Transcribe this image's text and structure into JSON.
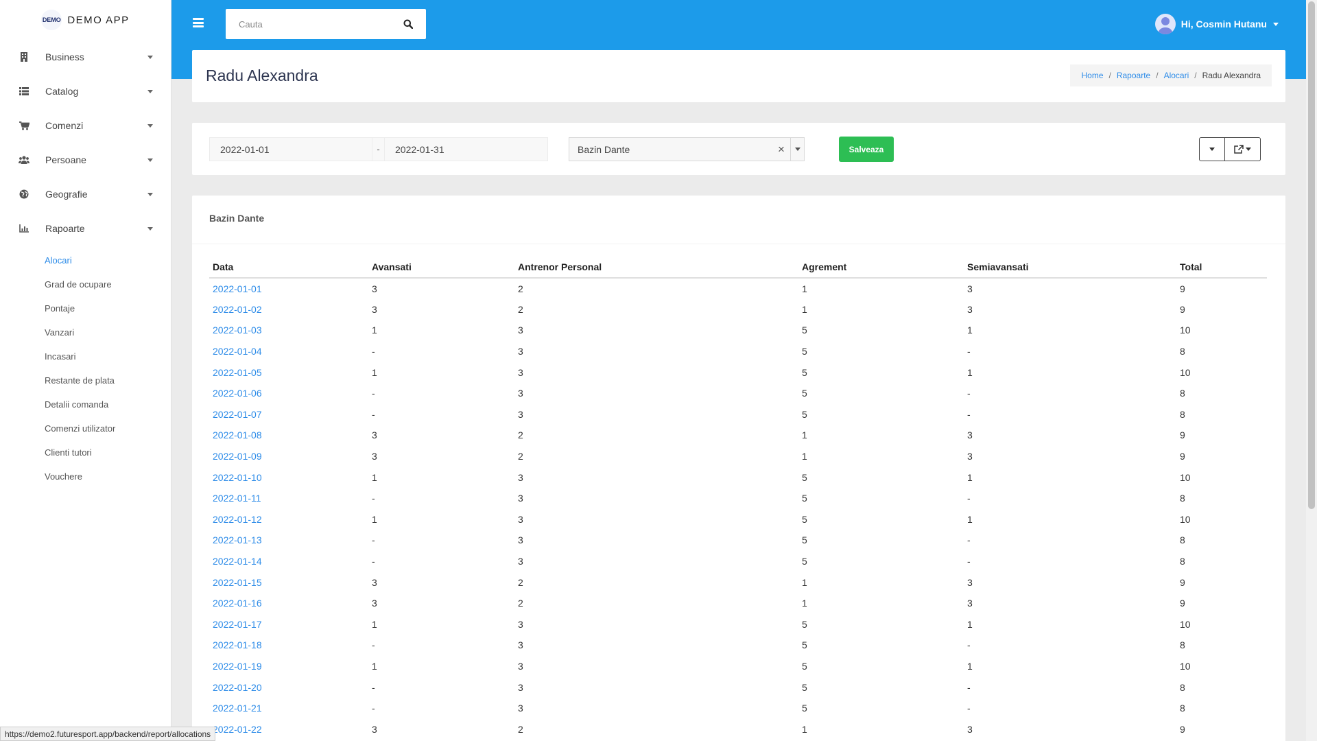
{
  "brand": {
    "logo_text": "DEMO",
    "app_name": "DEMO APP"
  },
  "sidebar": {
    "items": [
      {
        "label": "Business",
        "icon": "building-icon"
      },
      {
        "label": "Catalog",
        "icon": "list-icon"
      },
      {
        "label": "Comenzi",
        "icon": "cart-icon"
      },
      {
        "label": "Persoane",
        "icon": "users-icon"
      },
      {
        "label": "Geografie",
        "icon": "globe-icon"
      },
      {
        "label": "Rapoarte",
        "icon": "chart-icon"
      }
    ],
    "sub_items": [
      {
        "label": "Alocari",
        "active": true
      },
      {
        "label": "Grad de ocupare"
      },
      {
        "label": "Pontaje"
      },
      {
        "label": "Vanzari"
      },
      {
        "label": "Incasari"
      },
      {
        "label": "Restante de plata"
      },
      {
        "label": "Detalii comanda"
      },
      {
        "label": "Comenzi utilizator"
      },
      {
        "label": "Clienti tutori"
      },
      {
        "label": "Vouchere"
      }
    ]
  },
  "header": {
    "search_placeholder": "Cauta",
    "user_name": "Hi, Cosmin Hutanu",
    "accent_color": "#1c9bea"
  },
  "page": {
    "title": "Radu Alexandra",
    "breadcrumb": [
      "Home",
      "Rapoarte",
      "Alocari",
      "Radu Alexandra"
    ]
  },
  "filters": {
    "date_from": "2022-01-01",
    "date_separator": "-",
    "date_to": "2022-01-31",
    "location": "Bazin Dante",
    "save_label": "Salveaza",
    "save_color": "#2dbe54"
  },
  "report": {
    "card_title": "Bazin Dante",
    "columns": [
      "Data",
      "Avansati",
      "Antrenor Personal",
      "Agrement",
      "Semiavansati",
      "Total"
    ],
    "rows": [
      [
        "2022-01-01",
        "3",
        "2",
        "1",
        "3",
        "9"
      ],
      [
        "2022-01-02",
        "3",
        "2",
        "1",
        "3",
        "9"
      ],
      [
        "2022-01-03",
        "1",
        "3",
        "5",
        "1",
        "10"
      ],
      [
        "2022-01-04",
        "-",
        "3",
        "5",
        "-",
        "8"
      ],
      [
        "2022-01-05",
        "1",
        "3",
        "5",
        "1",
        "10"
      ],
      [
        "2022-01-06",
        "-",
        "3",
        "5",
        "-",
        "8"
      ],
      [
        "2022-01-07",
        "-",
        "3",
        "5",
        "-",
        "8"
      ],
      [
        "2022-01-08",
        "3",
        "2",
        "1",
        "3",
        "9"
      ],
      [
        "2022-01-09",
        "3",
        "2",
        "1",
        "3",
        "9"
      ],
      [
        "2022-01-10",
        "1",
        "3",
        "5",
        "1",
        "10"
      ],
      [
        "2022-01-11",
        "-",
        "3",
        "5",
        "-",
        "8"
      ],
      [
        "2022-01-12",
        "1",
        "3",
        "5",
        "1",
        "10"
      ],
      [
        "2022-01-13",
        "-",
        "3",
        "5",
        "-",
        "8"
      ],
      [
        "2022-01-14",
        "-",
        "3",
        "5",
        "-",
        "8"
      ],
      [
        "2022-01-15",
        "3",
        "2",
        "1",
        "3",
        "9"
      ],
      [
        "2022-01-16",
        "3",
        "2",
        "1",
        "3",
        "9"
      ],
      [
        "2022-01-17",
        "1",
        "3",
        "5",
        "1",
        "10"
      ],
      [
        "2022-01-18",
        "-",
        "3",
        "5",
        "-",
        "8"
      ],
      [
        "2022-01-19",
        "1",
        "3",
        "5",
        "1",
        "10"
      ],
      [
        "2022-01-20",
        "-",
        "3",
        "5",
        "-",
        "8"
      ],
      [
        "2022-01-21",
        "-",
        "3",
        "5",
        "-",
        "8"
      ],
      [
        "2022-01-22",
        "3",
        "2",
        "1",
        "3",
        "9"
      ]
    ]
  },
  "status_url": "https://demo2.futuresport.app/backend/report/allocations"
}
